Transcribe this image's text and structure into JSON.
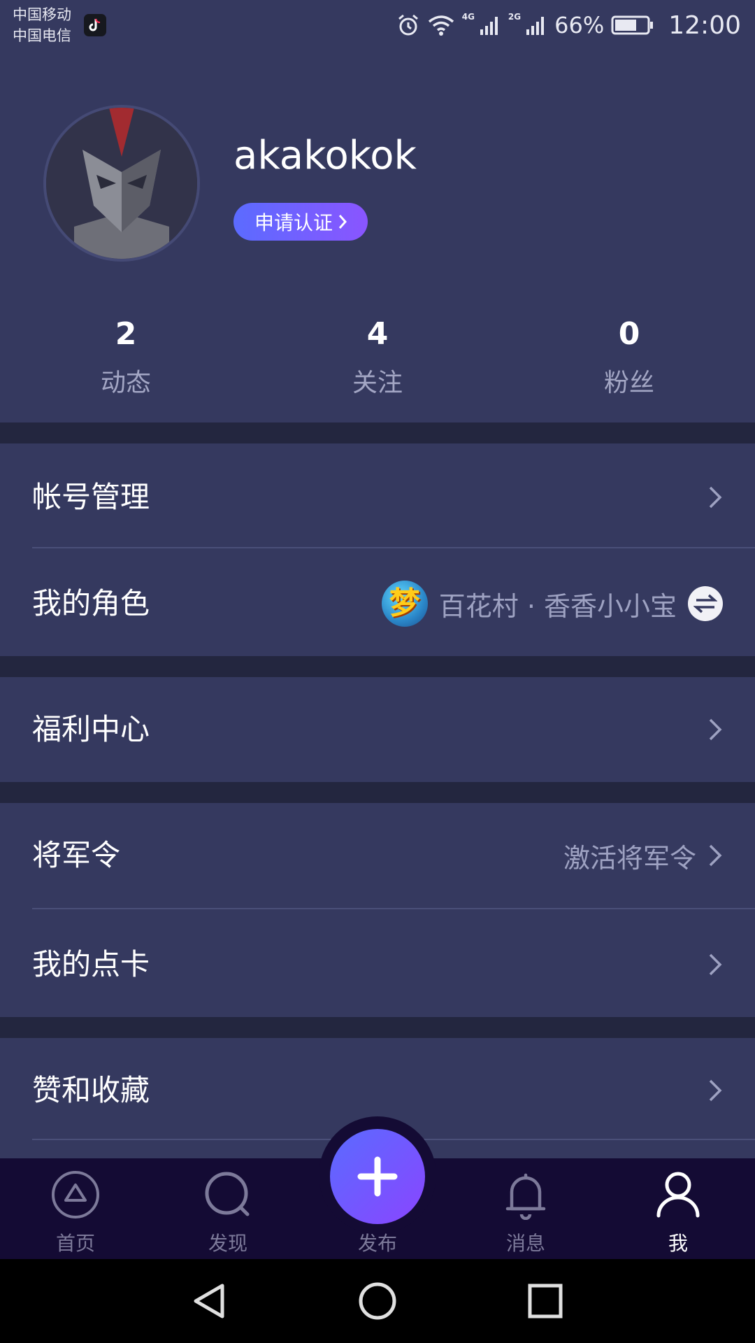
{
  "status_bar": {
    "carrier_1": "中国移动",
    "carrier_2": "中国电信",
    "net_1": "4G",
    "net_2": "2G",
    "battery": "66%",
    "time": "12:00"
  },
  "profile": {
    "username": "akakokok",
    "verify_label": "申请认证"
  },
  "stats": [
    {
      "value": "2",
      "label": "动态"
    },
    {
      "value": "4",
      "label": "关注"
    },
    {
      "value": "0",
      "label": "粉丝"
    }
  ],
  "menu": {
    "account": "帐号管理",
    "role": "我的角色",
    "role_value": "百花村 · 香香小小宝",
    "role_game_glyph": "梦",
    "welfare": "福利中心",
    "general": "将军令",
    "general_action": "激活将军令",
    "point_card": "我的点卡",
    "likes": "赞和收藏"
  },
  "bottom_nav": {
    "home": "首页",
    "discover": "发现",
    "publish": "发布",
    "messages": "消息",
    "me": "我"
  },
  "colors": {
    "background": "#35395f",
    "separator": "#23263f",
    "nav_bg": "#140b34",
    "accent": "#7a5cff"
  }
}
